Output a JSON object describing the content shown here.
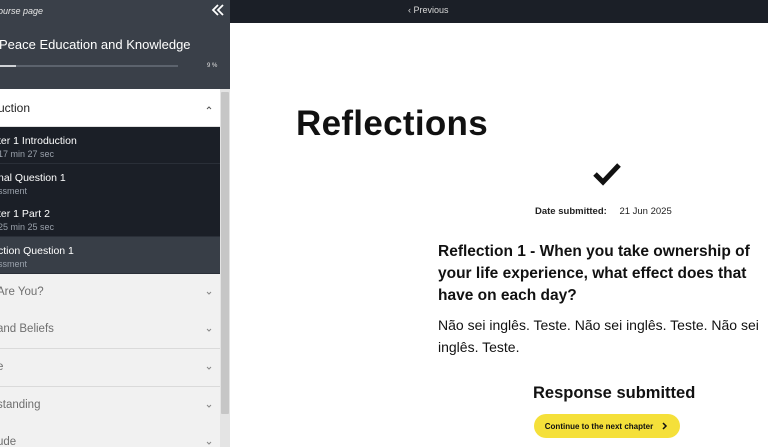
{
  "sidebar": {
    "back_link": "ourse page",
    "course_title": "Peace Education and Knowledge",
    "progress": {
      "percent": 9,
      "label": "9 %"
    },
    "active_section": "uction",
    "chapters": [
      {
        "title": "ter 1 Introduction",
        "meta": "17 min 27 sec",
        "current": false
      },
      {
        "title": "nal Question 1",
        "meta": "ssment",
        "current": false
      },
      {
        "title": "ter 1 Part 2",
        "meta": "25 min 25 sec",
        "current": false
      },
      {
        "title": "ction Question 1",
        "meta": "ssment",
        "current": true
      }
    ],
    "sections": [
      "Are You?",
      "and Beliefs",
      "e",
      "standing",
      "ude"
    ]
  },
  "topbar": {
    "previous": "‹ Previous"
  },
  "main": {
    "title": "Reflections",
    "date_label": "Date submitted:",
    "date_value": "21 Jun 2025",
    "question": "Reflection 1 - When you take ownership of your life experience, what effect does that have on each day?",
    "answer": "Não sei inglês. Teste. Não sei inglês. Teste. Não sei inglês. Teste.",
    "response_title": "Response submitted",
    "next_button": "Continue to the next chapter"
  },
  "colors": {
    "sidebar_header": "#3a4049",
    "chapter_bg": "#1b1f27",
    "chapter_current_bg": "#383e47",
    "accent_button": "#f5e03a"
  },
  "icons": [
    "collapse-double-chevron-icon",
    "chevron-up-icon",
    "chevron-down-icon",
    "checkmark-icon",
    "chevron-right-icon"
  ]
}
